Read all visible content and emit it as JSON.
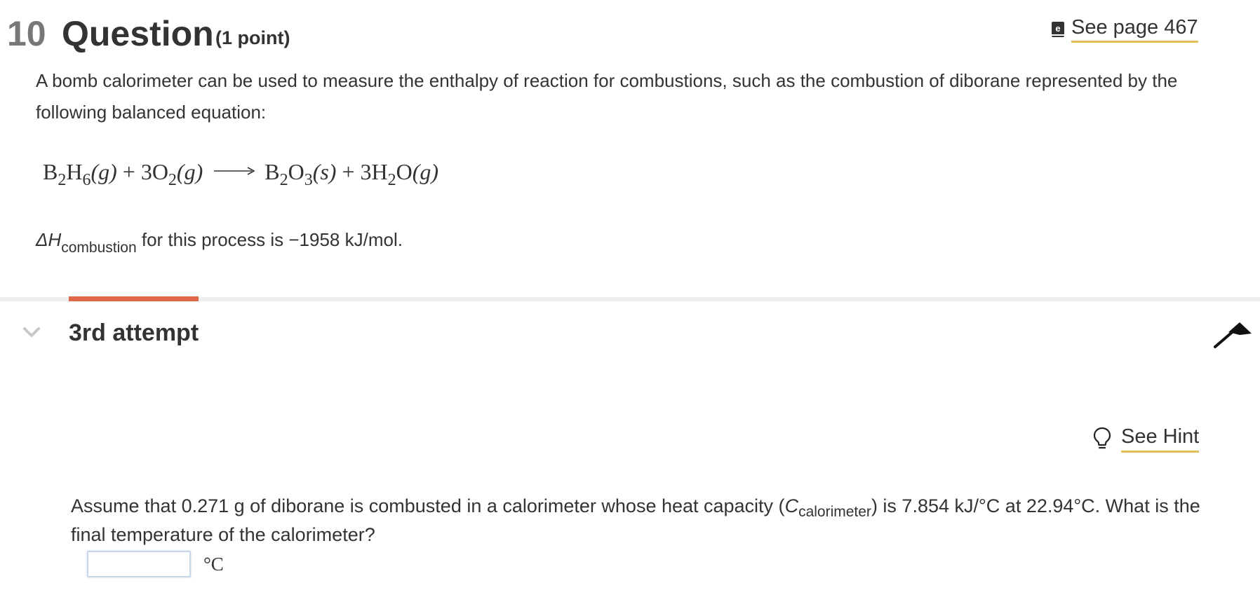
{
  "question": {
    "number": "10",
    "word": "Question",
    "points": "(1 point)",
    "see_page_label": "See page 467",
    "intro": "A bomb calorimeter can be used to measure the enthalpy of reaction for combustions, such as the combustion of diborane represented by the following balanced equation:",
    "equation": {
      "r1": "B",
      "r1_s1": "2",
      "r1_b": "H",
      "r1_s2": "6",
      "r1_state": "(g)",
      "plus1": " + ",
      "r2_coef": "3O",
      "r2_s": "2",
      "r2_state": "(g)",
      "p1": "B",
      "p1_s1": "2",
      "p1_b": "O",
      "p1_s2": "3",
      "p1_state": "(s)",
      "plus2": " + ",
      "p2_coef": "3H",
      "p2_s": "2",
      "p2_b": "O",
      "p2_state": "(g)"
    },
    "delta_h": {
      "symbol": "ΔH",
      "subscript": "combustion",
      "text": " for this process is −1958 kJ/mol."
    }
  },
  "attempt": {
    "label": "3rd attempt",
    "progress_fraction": 0.103
  },
  "hint": {
    "label": "See Hint"
  },
  "prompt": {
    "part1": "Assume that 0.271 g of diborane is combusted in a calorimeter whose heat capacity (",
    "symbol": "C",
    "subscript": "calorimeter",
    "part2": ") is 7.854 kJ/°C at 22.94°C. What is the final temperature of the calorimeter?"
  },
  "answer": {
    "value": "",
    "placeholder": "",
    "unit": "°C"
  },
  "colors": {
    "accent_underline": "#e1c15a",
    "progress": "#e0684a",
    "divider": "#eeeeee",
    "number_gray": "#777777"
  },
  "icons": {
    "book": "ebook-icon",
    "chevron": "chevron-down-icon",
    "flag": "flag-icon",
    "hint": "lightbulb-icon"
  }
}
